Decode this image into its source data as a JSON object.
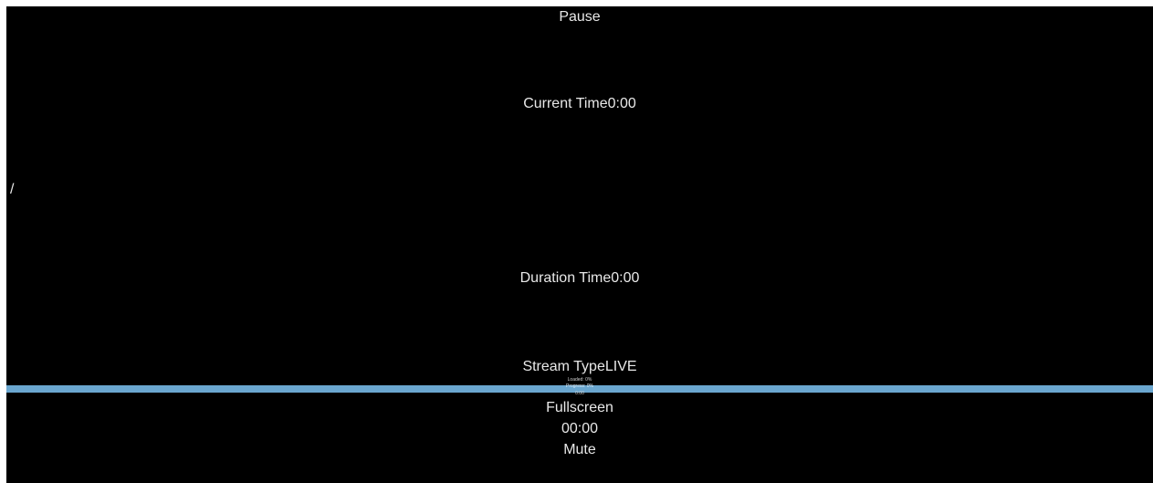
{
  "player": {
    "pause_label": "Pause",
    "current_time_label": "Current Time",
    "current_time_value": "0:00",
    "divider": "/",
    "duration_label": "Duration Time",
    "duration_value": "0:00",
    "stream_type_label": "Stream Type",
    "stream_type_value": "LIVE",
    "loaded_text": "Loaded: 0%",
    "progress_text": "Progress: 0%",
    "seek_time": "0:00",
    "fullscreen_label": "Fullscreen",
    "time_display": "00:00",
    "mute_label": "Mute",
    "progress_bar_color": "#6aa6cf",
    "loaded_fraction": 0,
    "progress_fraction": 0
  }
}
